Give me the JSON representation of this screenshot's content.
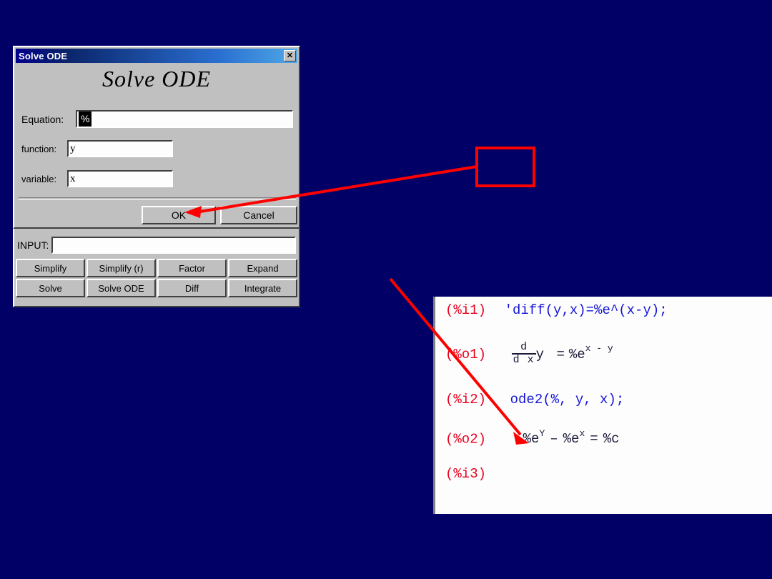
{
  "background": {
    "color": "#000066"
  },
  "annotation": {
    "color": "#ff0000",
    "highlight_box": {
      "label": ""
    }
  },
  "app_window": {
    "input_label": "INPUT:",
    "input_value": "",
    "input_placeholder": "",
    "buttons": [
      "Simplify",
      "Simplify (r)",
      "Factor",
      "Expand",
      "Solve",
      "Solve ODE",
      "Diff",
      "Integrate"
    ]
  },
  "dialog": {
    "titlebar_title": "Solve ODE",
    "close_label": "✕",
    "heading": "Solve ODE",
    "fields": [
      {
        "label": "Equation:",
        "value": "%",
        "selected": true
      },
      {
        "label": "function:",
        "value": "y",
        "selected": false
      },
      {
        "label": "variable:",
        "value": "x",
        "selected": false
      }
    ],
    "ok_label": "OK",
    "cancel_label": "Cancel"
  },
  "maxima": {
    "lines": [
      {
        "prompt": "(%i1)",
        "text": "'diff(y,x)=%e^(x-y);",
        "style": "blue"
      },
      {
        "prompt": "(%o1)",
        "text": "d/dx y = %e^(x - y)",
        "style": "dark"
      },
      {
        "prompt": "(%i2)",
        "text": "ode2(%, y, x);",
        "style": "blue"
      },
      {
        "prompt": "(%o2)",
        "text": "%e^Y - %e^x = %c",
        "style": "dark"
      },
      {
        "prompt": "(%i3)",
        "text": "",
        "style": "blue"
      }
    ],
    "o1_parts": {
      "num": "d",
      "den": "d x",
      "lhs_var": "y",
      "eq": "=",
      "base": "%e",
      "exponent": "x - y"
    },
    "o2_parts": {
      "term1_base": "%e",
      "term1_exp": "Y",
      "minus": "–",
      "term2_base": "%e",
      "term2_exp": "x",
      "eq": "=",
      "rhs": "%c"
    },
    "prompt_color": "#e8001e",
    "expr_color": "#1515d6"
  }
}
